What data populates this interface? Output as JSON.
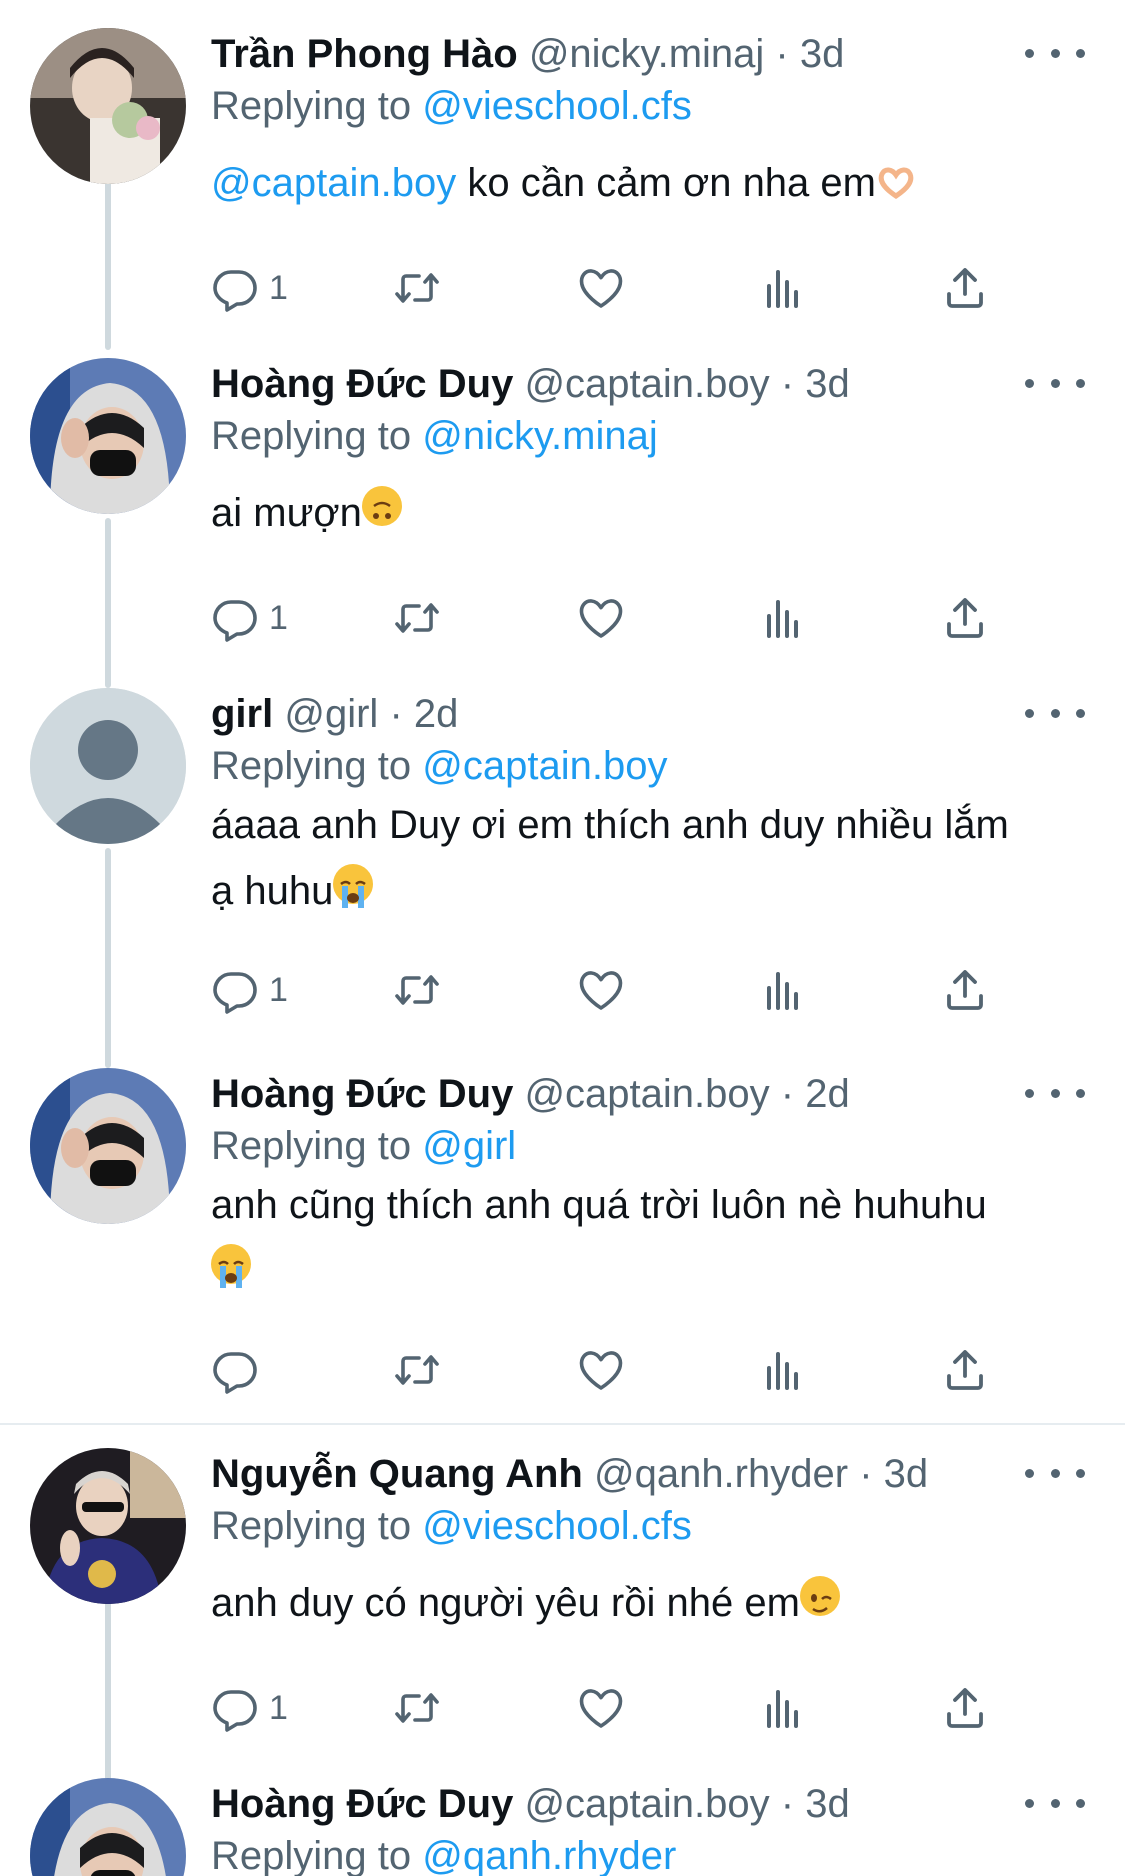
{
  "tweets": [
    {
      "name": "Trần Phong Hào",
      "handle": "@nicky.minaj",
      "time": "3d",
      "replying_label": "Replying to",
      "replying_to": "@vieschool.cfs",
      "mention": "@captain.boy",
      "text": "ko cần cảm ơn nha em",
      "emoji": "heart-hands",
      "reply_count": "1"
    },
    {
      "name": "Hoàng Đức Duy",
      "handle": "@captain.boy",
      "time": "3d",
      "replying_label": "Replying to",
      "replying_to": "@nicky.minaj",
      "text": "ai mượn",
      "emoji": "upside-down-face",
      "reply_count": "1"
    },
    {
      "name": "girl",
      "handle": "@girl",
      "time": "2d",
      "replying_label": "Replying to",
      "replying_to": "@captain.boy",
      "text_line1": "áaaa anh Duy ơi em thích anh duy nhiều lắm",
      "text_line2": "ạ huhu",
      "emoji": "loudly-crying-face",
      "reply_count": "1"
    },
    {
      "name": "Hoàng Đức Duy",
      "handle": "@captain.boy",
      "time": "2d",
      "replying_label": "Replying to",
      "replying_to": "@girl",
      "text": "anh cũng thích anh quá trời luôn nè huhuhu",
      "emoji": "loudly-crying-face",
      "reply_count": ""
    },
    {
      "name": "Nguyễn Quang Anh",
      "handle": "@qanh.rhyder",
      "time": "3d",
      "replying_label": "Replying to",
      "replying_to": "@vieschool.cfs",
      "text": "anh duy có người yêu rồi nhé em",
      "emoji": "winking-face",
      "reply_count": "1"
    },
    {
      "name": "Hoàng Đức Duy",
      "handle": "@captain.boy",
      "time": "3d",
      "replying_label": "Replying to",
      "replying_to": "@qanh.rhyder"
    }
  ],
  "separator": "·",
  "icons": [
    "reply-icon",
    "retweet-icon",
    "like-icon",
    "views-icon",
    "share-icon",
    "more-icon"
  ],
  "colors": {
    "link": "#1d9bf0",
    "secondary": "#536471",
    "thread": "#cfd9de"
  }
}
